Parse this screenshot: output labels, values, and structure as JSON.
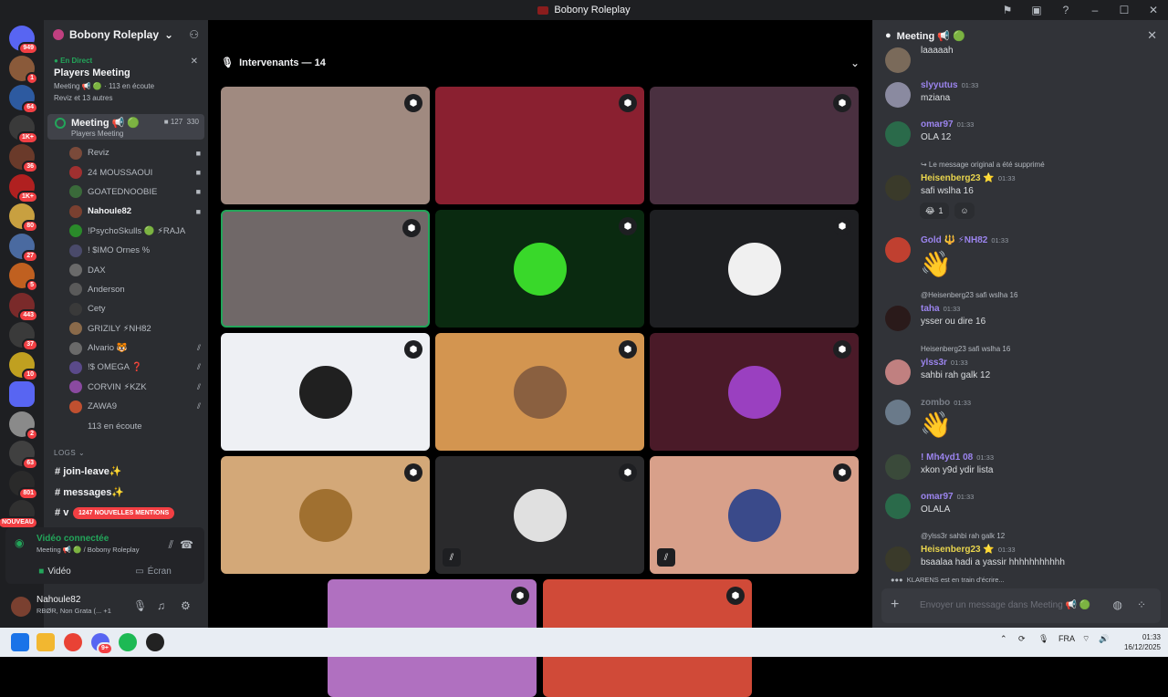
{
  "window": {
    "title": "Bobony Roleplay"
  },
  "guilds": [
    {
      "badge": "949",
      "color": "#5865f2"
    },
    {
      "badge": "1",
      "color": "#8a5a3a"
    },
    {
      "badge": "64",
      "color": "#2d5aa0"
    },
    {
      "badge": "1K+",
      "color": "#3a3a3a"
    },
    {
      "badge": "36",
      "color": "#6a3a2a"
    },
    {
      "badge": "1K+",
      "color": "#b02020"
    },
    {
      "badge": "80",
      "color": "#c8a040"
    },
    {
      "badge": "27",
      "color": "#4a6aa0"
    },
    {
      "badge": "5",
      "color": "#c06020"
    },
    {
      "badge": "443",
      "color": "#7a2a2a"
    },
    {
      "badge": "37",
      "color": "#3a3a3a"
    },
    {
      "badge": "10",
      "color": "#c0a020"
    },
    {
      "badge": "",
      "color": "#5865f2"
    },
    {
      "badge": "2",
      "color": "#8a8a8a"
    },
    {
      "badge": "63",
      "color": "#404040"
    },
    {
      "badge": "801",
      "color": "#2a2a2a"
    },
    {
      "badge": "NOUVEAU",
      "color": "#303030"
    }
  ],
  "server": {
    "name": "Bobony Roleplay"
  },
  "live": {
    "label": "En Direct",
    "title": "Players Meeting",
    "sub": "Meeting 📢 🟢 · 113 en écoute",
    "sub2": "Reviz et 13 autres"
  },
  "channel": {
    "name": "Meeting 📢 🟢",
    "topic": "Players Meeting",
    "count1": "127",
    "count2": "330"
  },
  "voice_users": [
    {
      "name": "Reviz",
      "color": "#7a4a3a"
    },
    {
      "name": "24 MOUSSAOUI",
      "color": "#a03030"
    },
    {
      "name": "GOATEDNOOBIE",
      "color": "#3a6a3a"
    },
    {
      "name": "Nahoule82",
      "color": "#7a4030"
    },
    {
      "name": "!PsychoSkulls 🟢 ⚡RAJA",
      "color": "#2a8a2a"
    },
    {
      "name": "! $IMO Ornes %",
      "color": "#4a4a6a"
    },
    {
      "name": "DAX",
      "color": "#6a6a6a"
    },
    {
      "name": "Anderson",
      "color": "#5a5a5a"
    },
    {
      "name": "Cety",
      "color": "#3a3a3a"
    },
    {
      "name": "GRIZILY ⚡NH82",
      "color": "#8a6a4a"
    },
    {
      "name": "Alvario 🐯",
      "color": "#6a6a6a"
    },
    {
      "name": "!$ OMEGA ❓",
      "color": "#5a4a8a"
    },
    {
      "name": "CORVIN ⚡KZK",
      "color": "#8a4aa0"
    },
    {
      "name": "ZAWA9",
      "color": "#c05030"
    },
    {
      "name": "113 en écoute",
      "color": "transparent"
    }
  ],
  "logs_category": "LOGS",
  "text_channels": [
    "join-leave✨",
    "messages✨",
    "v"
  ],
  "mentions": "1247 NOUVELLES MENTIONS",
  "voice_panel": {
    "status": "Vidéo connectée",
    "location": "Meeting 📢 🟢 / Bobony Roleplay",
    "video_btn": "Vidéo",
    "screen_btn": "Écran"
  },
  "user_panel": {
    "name": "Nahoule82",
    "status": "RBØR, Non Grata (... +1"
  },
  "stage": {
    "heading": "Intervenants — 14"
  },
  "tiles": [
    {
      "bg": "#a08a80",
      "avatar": "",
      "muted": false
    },
    {
      "bg": "#8a2030",
      "avatar": "",
      "muted": false
    },
    {
      "bg": "#4a3040",
      "avatar": "",
      "muted": false
    },
    {
      "bg": "#706868",
      "avatar": "",
      "muted": false
    },
    {
      "bg": "#0a2a10",
      "avatar": "#39d82a",
      "muted": false
    },
    {
      "bg": "#1e1f22",
      "avatar": "#f0f0f0",
      "muted": false
    },
    {
      "bg": "#eef0f4",
      "avatar": "#202020",
      "muted": false
    },
    {
      "bg": "#d39550",
      "avatar": "#8a6040",
      "muted": false
    },
    {
      "bg": "#4a1a28",
      "avatar": "#9a40c0",
      "muted": false
    },
    {
      "bg": "#d3a878",
      "avatar": "#a07030",
      "muted": false
    },
    {
      "bg": "#2a2a2c",
      "avatar": "#e0e0e0",
      "muted": true
    },
    {
      "bg": "#d8a08a",
      "avatar": "#3a4a8a",
      "muted": true
    },
    {
      "bg": "#b070c0",
      "avatar": "",
      "muted": false
    },
    {
      "bg": "#d04a38",
      "avatar": "",
      "muted": false
    }
  ],
  "chat": {
    "title": "Meeting 📢 🟢",
    "messages": [
      {
        "name": "",
        "time": "",
        "text": "laaaaah",
        "color": "#dbdee1",
        "reply": ""
      },
      {
        "name": "slyyutus",
        "time": "01:33",
        "text": "mziana",
        "color": "#9b84ee",
        "reply": ""
      },
      {
        "name": "omar97",
        "time": "01:33",
        "text": "OLA 12",
        "color": "#9b84ee",
        "reply": ""
      },
      {
        "name": "Heisenberg23 ⭐",
        "time": "01:33",
        "text": "safi wslha 16",
        "color": "#e8d44d",
        "reply": "↪ Le message original a été supprimé"
      },
      {
        "name": "Gold 🔱 ⚡NH82",
        "time": "01:33",
        "text": "",
        "color": "#9b84ee",
        "reply": ""
      },
      {
        "name": "taha",
        "time": "01:33",
        "text": "ysser ou dire 16",
        "color": "#9b84ee",
        "reply": "@Heisenberg23 safi wslha 16"
      },
      {
        "name": "ylss3r",
        "time": "01:33",
        "text": "sahbi rah galk 12",
        "color": "#9b84ee",
        "reply": "Heisenberg23 safi wslha 16"
      },
      {
        "name": "zombo",
        "time": "01:33",
        "text": "",
        "color": "#7a7f88",
        "reply": ""
      },
      {
        "name": "! Mh4yd1 08",
        "time": "01:33",
        "text": "xkon y9d ydir lista",
        "color": "#9b84ee",
        "reply": ""
      },
      {
        "name": "omar97",
        "time": "01:33",
        "text": "OLALA",
        "color": "#9b84ee",
        "reply": ""
      },
      {
        "name": "Heisenberg23 ⭐",
        "time": "01:33",
        "text": "bsaalaa hadi a yassir hhhhhhhhhhh",
        "color": "#e8d44d",
        "reply": "@ylss3r sahbi rah galk 12"
      }
    ],
    "reaction_count": "1",
    "typing": "KLARENS est en train d'écrire...",
    "input_placeholder": "Envoyer un message dans Meeting 📢 🟢"
  },
  "taskbar": {
    "lang": "FRA",
    "time": "01:33",
    "date": "16/12/2025",
    "discord_badge": "9+"
  }
}
